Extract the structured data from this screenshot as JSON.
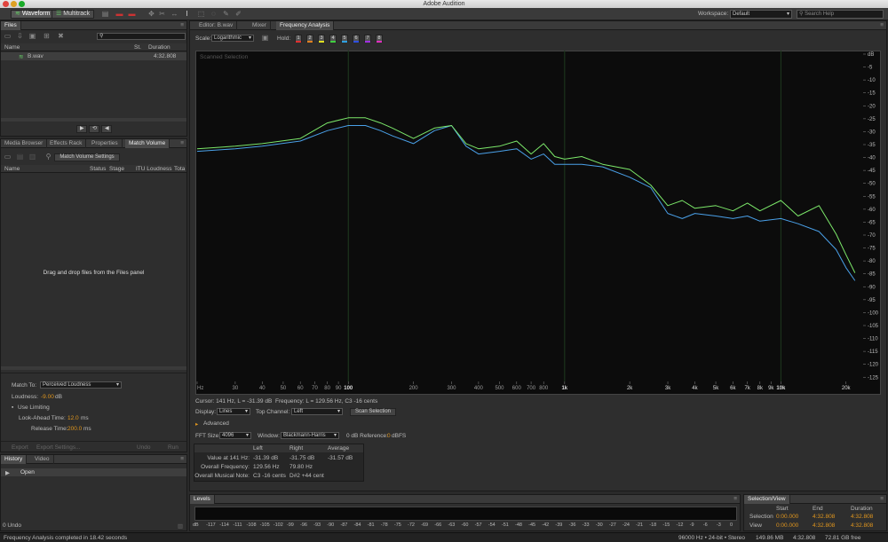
{
  "app": {
    "title": "Adobe Audition"
  },
  "toolbar": {
    "waveform": "Waveform",
    "multitrack": "Multitrack",
    "workspace_label": "Workspace:",
    "workspace_value": "Default",
    "search_placeholder": "Search Help"
  },
  "files": {
    "title": "Files",
    "col_name": "Name",
    "col_st": "St.",
    "col_duration": "Duration",
    "file_name": "B.wav",
    "file_duration": "4:32.808"
  },
  "middle": {
    "tabs": [
      "Media Browser",
      "Effects Rack",
      "Properties",
      "Match Volume"
    ],
    "settings_btn": "Match Volume Settings",
    "cols": [
      "Name",
      "Status",
      "Stage",
      "ITU Loudness",
      "Tota"
    ],
    "drop_text": "Drag and drop files from the Files panel"
  },
  "match": {
    "match_to_label": "Match To:",
    "match_to_value": "Perceived Loudness",
    "loudness_label": "Loudness:",
    "loudness_value": "-9.00",
    "loudness_unit": "dB",
    "limiting_label": "Use Limiting",
    "lookahead_label": "Look-Ahead Time:",
    "lookahead_value": "12.0",
    "lookahead_unit": "ms",
    "release_label": "Release Time:",
    "release_value": "200.0",
    "release_unit": "ms",
    "export": "Export",
    "export_settings": "Export Settings...",
    "undo": "Undo",
    "run": "Run"
  },
  "history": {
    "tabs": [
      "History",
      "Video"
    ],
    "item": "Open",
    "undos": "0 Undo"
  },
  "editor": {
    "tabs": [
      "Editor: B.wav",
      "Mixer",
      "Frequency Analysis"
    ],
    "scale_label": "Scale:",
    "scale_value": "Logarithmic",
    "hold_label": "Hold:",
    "hold_buttons": [
      "1",
      "2",
      "3",
      "4",
      "5",
      "6",
      "7",
      "8"
    ],
    "hold_colors": [
      "#e03030",
      "#e08020",
      "#e0e020",
      "#40d040",
      "#30a0e0",
      "#3050e0",
      "#a030e0",
      "#e030c0"
    ],
    "graph_label": "Scanned Selection"
  },
  "chart_data": {
    "type": "line",
    "xscale": "log",
    "xlim": [
      20,
      24000
    ],
    "ylim": [
      -128,
      0
    ],
    "x_ticks": [
      {
        "v": 20,
        "t": "Hz"
      },
      {
        "v": 30,
        "t": "30"
      },
      {
        "v": 40,
        "t": "40"
      },
      {
        "v": 50,
        "t": "50"
      },
      {
        "v": 60,
        "t": "60"
      },
      {
        "v": 70,
        "t": "70"
      },
      {
        "v": 80,
        "t": "80"
      },
      {
        "v": 90,
        "t": "90"
      },
      {
        "v": 100,
        "t": "100"
      },
      {
        "v": 200,
        "t": "200"
      },
      {
        "v": 300,
        "t": "300"
      },
      {
        "v": 400,
        "t": "400"
      },
      {
        "v": 500,
        "t": "500"
      },
      {
        "v": 600,
        "t": "600"
      },
      {
        "v": 700,
        "t": "700"
      },
      {
        "v": 800,
        "t": "800"
      },
      {
        "v": 1000,
        "t": "1k"
      },
      {
        "v": 2000,
        "t": "2k"
      },
      {
        "v": 3000,
        "t": "3k"
      },
      {
        "v": 4000,
        "t": "4k"
      },
      {
        "v": 5000,
        "t": "5k"
      },
      {
        "v": 6000,
        "t": "6k"
      },
      {
        "v": 7000,
        "t": "7k"
      },
      {
        "v": 8000,
        "t": "8k"
      },
      {
        "v": 9000,
        "t": "9k"
      },
      {
        "v": 10000,
        "t": "10k"
      },
      {
        "v": 20000,
        "t": "20k"
      }
    ],
    "y_ticks": [
      "dB",
      "-5",
      "-10",
      "-15",
      "-20",
      "-25",
      "-30",
      "-35",
      "-40",
      "-45",
      "-50",
      "-55",
      "-60",
      "-65",
      "-70",
      "-75",
      "-80",
      "-85",
      "-90",
      "-95",
      "-100",
      "-105",
      "-110",
      "-115",
      "-120",
      "-125"
    ],
    "series": [
      {
        "color": "#4aa0e8",
        "x": [
          20,
          30,
          40,
          60,
          80,
          100,
          120,
          141,
          160,
          200,
          250,
          300,
          350,
          400,
          500,
          600,
          700,
          800,
          900,
          1000,
          1200,
          1500,
          2000,
          2500,
          3000,
          3500,
          4000,
          5000,
          6000,
          7000,
          8000,
          10000,
          12000,
          15000,
          18000,
          20000,
          22000
        ],
        "y": [
          -39,
          -38,
          -37,
          -35,
          -31,
          -29,
          -29,
          -31,
          -33,
          -36,
          -31,
          -29,
          -37,
          -40,
          -39,
          -38,
          -42,
          -40,
          -44,
          -44,
          -44,
          -45,
          -49,
          -53,
          -63,
          -65,
          -63,
          -64,
          -65,
          -64,
          -66,
          -65,
          -67,
          -70,
          -77,
          -84,
          -89
        ]
      },
      {
        "color": "#7ce86a",
        "x": [
          20,
          30,
          40,
          60,
          80,
          100,
          120,
          141,
          160,
          200,
          250,
          300,
          350,
          400,
          500,
          600,
          700,
          800,
          900,
          1000,
          1200,
          1500,
          2000,
          2500,
          3000,
          3500,
          4000,
          5000,
          6000,
          7000,
          8000,
          10000,
          12000,
          15000,
          18000,
          20000,
          22000
        ],
        "y": [
          -38,
          -37,
          -36,
          -34,
          -28,
          -26,
          -26,
          -28,
          -30,
          -34,
          -30,
          -29,
          -36,
          -38,
          -37,
          -35,
          -40,
          -36,
          -41,
          -42,
          -41,
          -44,
          -46,
          -52,
          -60,
          -58,
          -61,
          -60,
          -62,
          -59,
          -62,
          -58,
          -64,
          -60,
          -71,
          -79,
          -86
        ]
      }
    ]
  },
  "readout": {
    "cursor": "Cursor: 141 Hz, L = -31.39 dB",
    "frequency": "Frequency: L = 129.56 Hz, C3 -16 cents"
  },
  "options": {
    "display_label": "Display:",
    "display_value": "Lines",
    "top_channel_label": "Top Channel:",
    "top_channel_value": "Left",
    "scan_btn": "Scan Selection",
    "advanced": "Advanced",
    "fft_label": "FFT Size:",
    "fft_value": "4096",
    "window_label": "Window:",
    "window_value": "Blackmann-Harris",
    "ref_label": "0 dB Reference:",
    "ref_value": "0",
    "ref_unit": "dBFS"
  },
  "table": {
    "headers": [
      "Left",
      "Right",
      "Average"
    ],
    "rows": [
      {
        "label": "Value at 141 Hz:",
        "cells": [
          "-31.39 dB",
          "-31.75 dB",
          "-31.57 dB"
        ]
      },
      {
        "label": "Overall Frequency:",
        "cells": [
          "129.56 Hz",
          "79.80 Hz",
          ""
        ]
      },
      {
        "label": "Overall Musical Note:",
        "cells": [
          "C3 -16 cents",
          "D#2 +44 cent",
          ""
        ]
      }
    ]
  },
  "levels": {
    "title": "Levels",
    "scale": [
      "dB",
      "-117",
      "-114",
      "-111",
      "-108",
      "-105",
      "-102",
      "-99",
      "-96",
      "-93",
      "-90",
      "-87",
      "-84",
      "-81",
      "-78",
      "-75",
      "-72",
      "-69",
      "-66",
      "-63",
      "-60",
      "-57",
      "-54",
      "-51",
      "-48",
      "-45",
      "-42",
      "-39",
      "-36",
      "-33",
      "-30",
      "-27",
      "-24",
      "-21",
      "-18",
      "-15",
      "-12",
      "-9",
      "-6",
      "-3",
      "0"
    ]
  },
  "selection": {
    "title": "Selection/View",
    "col_start": "Start",
    "col_end": "End",
    "col_duration": "Duration",
    "sel_label": "Selection",
    "sel_start": "0:00.000",
    "sel_end": "4:32.808",
    "sel_duration": "4:32.808",
    "view_label": "View",
    "view_start": "0:00.000",
    "view_end": "4:32.808",
    "view_duration": "4:32.808"
  },
  "status": {
    "message": "Frequency Analysis completed in 18.42 seconds",
    "format": "96000 Hz • 24-bit • Stereo",
    "size": "149.86 MB",
    "duration": "4:32.808",
    "free": "72.81 GB free"
  }
}
